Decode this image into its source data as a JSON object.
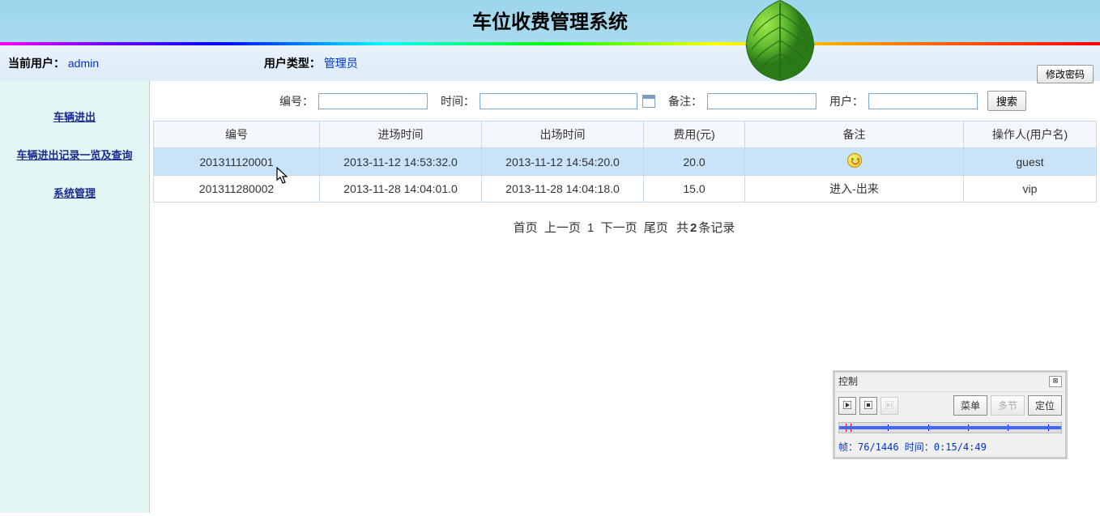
{
  "header": {
    "title": "车位收费管理系统"
  },
  "user_bar": {
    "current_user_label": "当前用户：",
    "current_user": "admin",
    "user_type_label": "用户类型：",
    "user_type": "管理员",
    "change_pwd": "修改密码"
  },
  "sidebar": {
    "items": [
      {
        "label": "车辆进出"
      },
      {
        "label": "车辆进出记录一览及查询"
      },
      {
        "label": "系统管理"
      }
    ]
  },
  "search": {
    "id_label": "编号：",
    "time_label": "时间：",
    "note_label": "备注：",
    "user_label": "用户：",
    "btn_label": "搜索",
    "id_value": "",
    "time_value": "",
    "note_value": "",
    "user_value": ""
  },
  "table": {
    "headers": [
      "编号",
      "进场时间",
      "出场时间",
      "费用(元)",
      "备注",
      "操作人(用户名)"
    ],
    "rows": [
      {
        "id": "201311120001",
        "in_time": "2013-11-12 14:53:32.0",
        "out_time": "2013-11-12 14:54:20.0",
        "fee": "20.0",
        "note_type": "smiley",
        "note": "",
        "user": "guest",
        "highlight": true
      },
      {
        "id": "201311280002",
        "in_time": "2013-11-28 14:04:01.0",
        "out_time": "2013-11-28 14:04:18.0",
        "fee": "15.0",
        "note_type": "text",
        "note": "进入-出来",
        "user": "vip",
        "highlight": false
      }
    ]
  },
  "pagination": {
    "first": "首页",
    "prev": "上一页",
    "page": "1",
    "next": "下一页",
    "last": "尾页",
    "total_prefix": "共",
    "total_count": "2",
    "total_suffix": "条记录"
  },
  "control": {
    "title": "控制",
    "btn_play": "▶",
    "btn_stop": "◼",
    "btn_next": "▶|",
    "btn_menu": "菜单",
    "btn_multi": "多节",
    "btn_locate": "定位",
    "status": "帧：76/1446 时间：0:15/4:49",
    "marks": [
      {
        "pos": 3,
        "type": "red"
      },
      {
        "pos": 5,
        "type": "red"
      },
      {
        "pos": 22,
        "type": "blue"
      },
      {
        "pos": 40,
        "type": "blue"
      },
      {
        "pos": 58,
        "type": "blue"
      },
      {
        "pos": 76,
        "type": "blue"
      },
      {
        "pos": 94,
        "type": "blue"
      }
    ]
  }
}
